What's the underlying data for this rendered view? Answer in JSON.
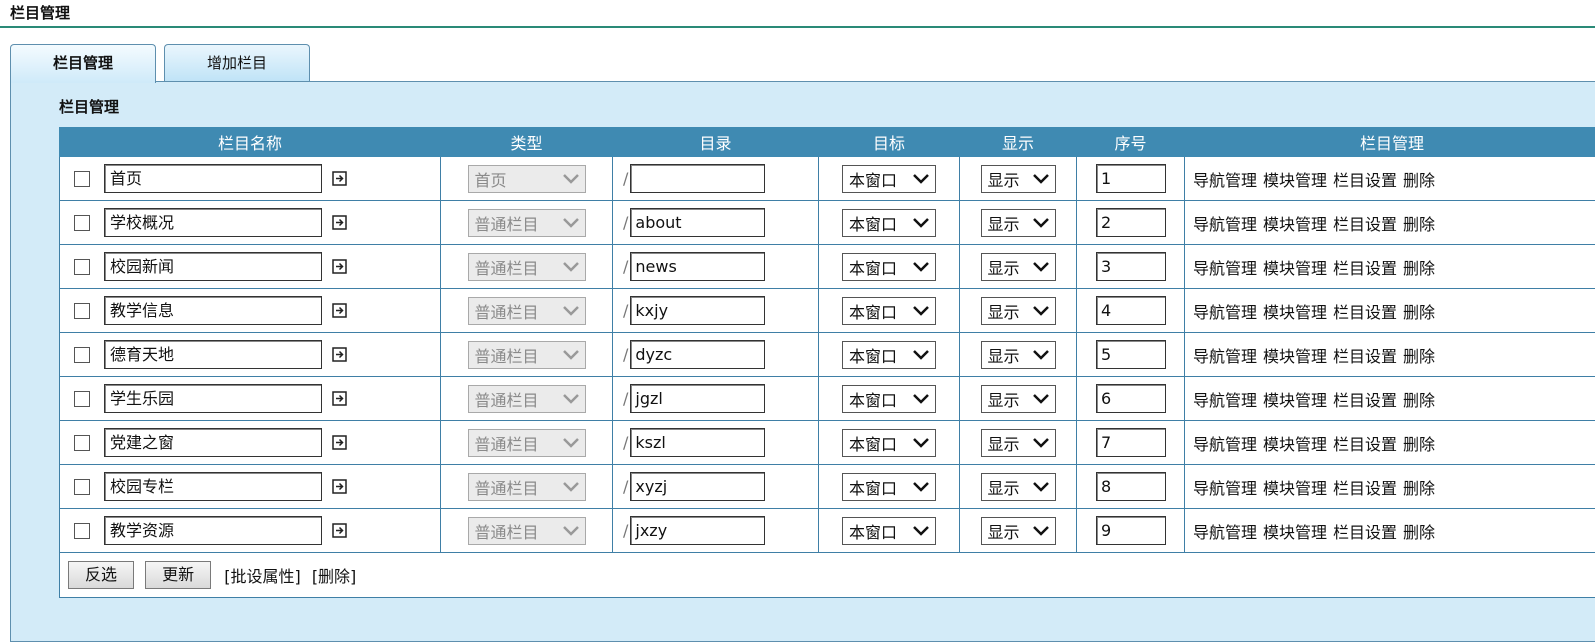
{
  "page": {
    "title": "栏目管理"
  },
  "tabs": [
    {
      "label": "栏目管理",
      "active": true
    },
    {
      "label": "增加栏目",
      "active": false
    }
  ],
  "panel": {
    "title": "栏目管理"
  },
  "table": {
    "headers": [
      "栏目名称",
      "类型",
      "目录",
      "目标",
      "显示",
      "序号",
      "栏目管理"
    ],
    "rows": [
      {
        "name": "首页",
        "type": "首页",
        "dir_prefix": "/",
        "dir": "",
        "target": "本窗口",
        "display": "显示",
        "order": "1"
      },
      {
        "name": "学校概况",
        "type": "普通栏目",
        "dir_prefix": "/",
        "dir": "about",
        "target": "本窗口",
        "display": "显示",
        "order": "2"
      },
      {
        "name": "校园新闻",
        "type": "普通栏目",
        "dir_prefix": "/",
        "dir": "news",
        "target": "本窗口",
        "display": "显示",
        "order": "3"
      },
      {
        "name": "教学信息",
        "type": "普通栏目",
        "dir_prefix": "/",
        "dir": "kxjy",
        "target": "本窗口",
        "display": "显示",
        "order": "4"
      },
      {
        "name": "德育天地",
        "type": "普通栏目",
        "dir_prefix": "/",
        "dir": "dyzc",
        "target": "本窗口",
        "display": "显示",
        "order": "5"
      },
      {
        "name": "学生乐园",
        "type": "普通栏目",
        "dir_prefix": "/",
        "dir": "jgzl",
        "target": "本窗口",
        "display": "显示",
        "order": "6"
      },
      {
        "name": "党建之窗",
        "type": "普通栏目",
        "dir_prefix": "/",
        "dir": "kszl",
        "target": "本窗口",
        "display": "显示",
        "order": "7"
      },
      {
        "name": "校园专栏",
        "type": "普通栏目",
        "dir_prefix": "/",
        "dir": "xyzj",
        "target": "本窗口",
        "display": "显示",
        "order": "8"
      },
      {
        "name": "教学资源",
        "type": "普通栏目",
        "dir_prefix": "/",
        "dir": "jxzy",
        "target": "本窗口",
        "display": "显示",
        "order": "9"
      }
    ],
    "row_actions": [
      "导航管理",
      "模块管理",
      "栏目设置",
      "删除"
    ]
  },
  "footer": {
    "invert_label": "反选",
    "update_label": "更新",
    "batch_label": "[批设属性]",
    "delete_label": "[删除]"
  },
  "icons": {
    "external": "external-link-icon",
    "dropdown": "chevron-down-icon"
  },
  "colors": {
    "header_bg": "#3f8ab2",
    "panel_bg": "#d3ebf8",
    "accent_line": "#2a8a77"
  }
}
